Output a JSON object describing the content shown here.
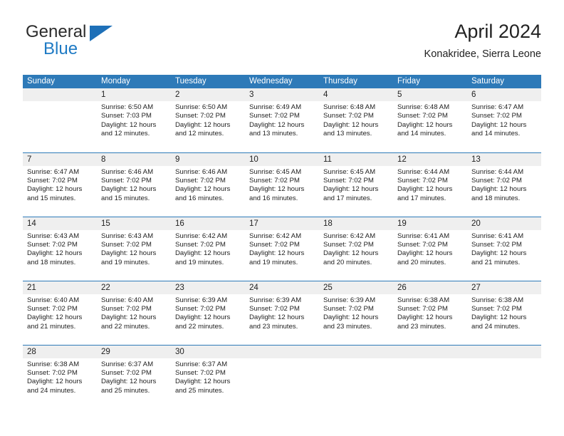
{
  "brand": {
    "name_part1": "General",
    "name_part2": "Blue",
    "triangle_color": "#1e70b8",
    "blue_color": "#1e7ac4"
  },
  "header": {
    "title": "April 2024",
    "subtitle": "Konakridee, Sierra Leone"
  },
  "theme": {
    "header_blue": "#2e7ab8",
    "daynum_band": "#efefef",
    "text": "#222222",
    "rule_blue": "#2e7ab8"
  },
  "weekdays": [
    "Sunday",
    "Monday",
    "Tuesday",
    "Wednesday",
    "Thursday",
    "Friday",
    "Saturday"
  ],
  "labels": {
    "sunrise_prefix": "Sunrise:",
    "sunset_prefix": "Sunset:",
    "daylight_prefix": "Daylight:"
  },
  "weeks": [
    [
      {
        "day": "",
        "empty": true,
        "l1": "",
        "l2": "",
        "l3": "",
        "l4": ""
      },
      {
        "day": "1",
        "empty": false,
        "l1": "Sunrise: 6:50 AM",
        "l2": "Sunset: 7:03 PM",
        "l3": "Daylight: 12 hours",
        "l4": "and 12 minutes."
      },
      {
        "day": "2",
        "empty": false,
        "l1": "Sunrise: 6:50 AM",
        "l2": "Sunset: 7:02 PM",
        "l3": "Daylight: 12 hours",
        "l4": "and 12 minutes."
      },
      {
        "day": "3",
        "empty": false,
        "l1": "Sunrise: 6:49 AM",
        "l2": "Sunset: 7:02 PM",
        "l3": "Daylight: 12 hours",
        "l4": "and 13 minutes."
      },
      {
        "day": "4",
        "empty": false,
        "l1": "Sunrise: 6:48 AM",
        "l2": "Sunset: 7:02 PM",
        "l3": "Daylight: 12 hours",
        "l4": "and 13 minutes."
      },
      {
        "day": "5",
        "empty": false,
        "l1": "Sunrise: 6:48 AM",
        "l2": "Sunset: 7:02 PM",
        "l3": "Daylight: 12 hours",
        "l4": "and 14 minutes."
      },
      {
        "day": "6",
        "empty": false,
        "l1": "Sunrise: 6:47 AM",
        "l2": "Sunset: 7:02 PM",
        "l3": "Daylight: 12 hours",
        "l4": "and 14 minutes."
      }
    ],
    [
      {
        "day": "7",
        "empty": false,
        "l1": "Sunrise: 6:47 AM",
        "l2": "Sunset: 7:02 PM",
        "l3": "Daylight: 12 hours",
        "l4": "and 15 minutes."
      },
      {
        "day": "8",
        "empty": false,
        "l1": "Sunrise: 6:46 AM",
        "l2": "Sunset: 7:02 PM",
        "l3": "Daylight: 12 hours",
        "l4": "and 15 minutes."
      },
      {
        "day": "9",
        "empty": false,
        "l1": "Sunrise: 6:46 AM",
        "l2": "Sunset: 7:02 PM",
        "l3": "Daylight: 12 hours",
        "l4": "and 16 minutes."
      },
      {
        "day": "10",
        "empty": false,
        "l1": "Sunrise: 6:45 AM",
        "l2": "Sunset: 7:02 PM",
        "l3": "Daylight: 12 hours",
        "l4": "and 16 minutes."
      },
      {
        "day": "11",
        "empty": false,
        "l1": "Sunrise: 6:45 AM",
        "l2": "Sunset: 7:02 PM",
        "l3": "Daylight: 12 hours",
        "l4": "and 17 minutes."
      },
      {
        "day": "12",
        "empty": false,
        "l1": "Sunrise: 6:44 AM",
        "l2": "Sunset: 7:02 PM",
        "l3": "Daylight: 12 hours",
        "l4": "and 17 minutes."
      },
      {
        "day": "13",
        "empty": false,
        "l1": "Sunrise: 6:44 AM",
        "l2": "Sunset: 7:02 PM",
        "l3": "Daylight: 12 hours",
        "l4": "and 18 minutes."
      }
    ],
    [
      {
        "day": "14",
        "empty": false,
        "l1": "Sunrise: 6:43 AM",
        "l2": "Sunset: 7:02 PM",
        "l3": "Daylight: 12 hours",
        "l4": "and 18 minutes."
      },
      {
        "day": "15",
        "empty": false,
        "l1": "Sunrise: 6:43 AM",
        "l2": "Sunset: 7:02 PM",
        "l3": "Daylight: 12 hours",
        "l4": "and 19 minutes."
      },
      {
        "day": "16",
        "empty": false,
        "l1": "Sunrise: 6:42 AM",
        "l2": "Sunset: 7:02 PM",
        "l3": "Daylight: 12 hours",
        "l4": "and 19 minutes."
      },
      {
        "day": "17",
        "empty": false,
        "l1": "Sunrise: 6:42 AM",
        "l2": "Sunset: 7:02 PM",
        "l3": "Daylight: 12 hours",
        "l4": "and 19 minutes."
      },
      {
        "day": "18",
        "empty": false,
        "l1": "Sunrise: 6:42 AM",
        "l2": "Sunset: 7:02 PM",
        "l3": "Daylight: 12 hours",
        "l4": "and 20 minutes."
      },
      {
        "day": "19",
        "empty": false,
        "l1": "Sunrise: 6:41 AM",
        "l2": "Sunset: 7:02 PM",
        "l3": "Daylight: 12 hours",
        "l4": "and 20 minutes."
      },
      {
        "day": "20",
        "empty": false,
        "l1": "Sunrise: 6:41 AM",
        "l2": "Sunset: 7:02 PM",
        "l3": "Daylight: 12 hours",
        "l4": "and 21 minutes."
      }
    ],
    [
      {
        "day": "21",
        "empty": false,
        "l1": "Sunrise: 6:40 AM",
        "l2": "Sunset: 7:02 PM",
        "l3": "Daylight: 12 hours",
        "l4": "and 21 minutes."
      },
      {
        "day": "22",
        "empty": false,
        "l1": "Sunrise: 6:40 AM",
        "l2": "Sunset: 7:02 PM",
        "l3": "Daylight: 12 hours",
        "l4": "and 22 minutes."
      },
      {
        "day": "23",
        "empty": false,
        "l1": "Sunrise: 6:39 AM",
        "l2": "Sunset: 7:02 PM",
        "l3": "Daylight: 12 hours",
        "l4": "and 22 minutes."
      },
      {
        "day": "24",
        "empty": false,
        "l1": "Sunrise: 6:39 AM",
        "l2": "Sunset: 7:02 PM",
        "l3": "Daylight: 12 hours",
        "l4": "and 23 minutes."
      },
      {
        "day": "25",
        "empty": false,
        "l1": "Sunrise: 6:39 AM",
        "l2": "Sunset: 7:02 PM",
        "l3": "Daylight: 12 hours",
        "l4": "and 23 minutes."
      },
      {
        "day": "26",
        "empty": false,
        "l1": "Sunrise: 6:38 AM",
        "l2": "Sunset: 7:02 PM",
        "l3": "Daylight: 12 hours",
        "l4": "and 23 minutes."
      },
      {
        "day": "27",
        "empty": false,
        "l1": "Sunrise: 6:38 AM",
        "l2": "Sunset: 7:02 PM",
        "l3": "Daylight: 12 hours",
        "l4": "and 24 minutes."
      }
    ],
    [
      {
        "day": "28",
        "empty": false,
        "l1": "Sunrise: 6:38 AM",
        "l2": "Sunset: 7:02 PM",
        "l3": "Daylight: 12 hours",
        "l4": "and 24 minutes."
      },
      {
        "day": "29",
        "empty": false,
        "l1": "Sunrise: 6:37 AM",
        "l2": "Sunset: 7:02 PM",
        "l3": "Daylight: 12 hours",
        "l4": "and 25 minutes."
      },
      {
        "day": "30",
        "empty": false,
        "l1": "Sunrise: 6:37 AM",
        "l2": "Sunset: 7:02 PM",
        "l3": "Daylight: 12 hours",
        "l4": "and 25 minutes."
      },
      {
        "day": "",
        "empty": true,
        "l1": "",
        "l2": "",
        "l3": "",
        "l4": ""
      },
      {
        "day": "",
        "empty": true,
        "l1": "",
        "l2": "",
        "l3": "",
        "l4": ""
      },
      {
        "day": "",
        "empty": true,
        "l1": "",
        "l2": "",
        "l3": "",
        "l4": ""
      },
      {
        "day": "",
        "empty": true,
        "l1": "",
        "l2": "",
        "l3": "",
        "l4": ""
      }
    ]
  ]
}
